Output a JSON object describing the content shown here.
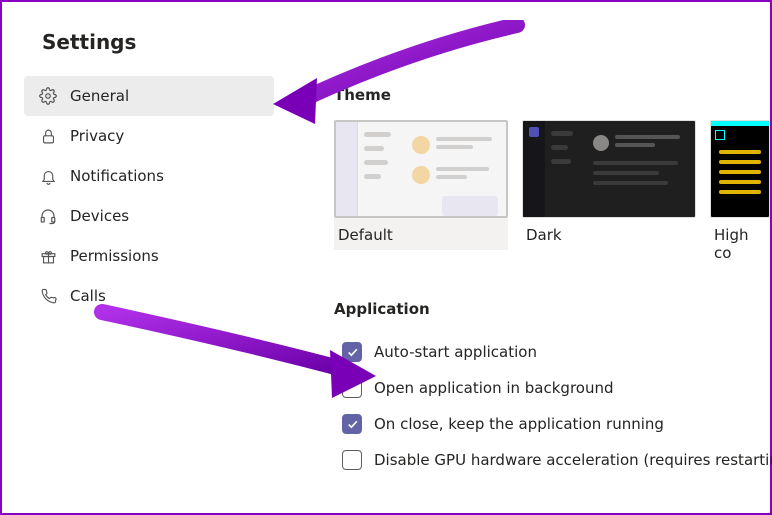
{
  "title": "Settings",
  "accent": "#6264a7",
  "annotation_color": "#8a00c2",
  "sidebar": {
    "items": [
      {
        "label": "General",
        "icon": "gear-icon",
        "active": true
      },
      {
        "label": "Privacy",
        "icon": "lock-icon",
        "active": false
      },
      {
        "label": "Notifications",
        "icon": "bell-icon",
        "active": false
      },
      {
        "label": "Devices",
        "icon": "headset-icon",
        "active": false
      },
      {
        "label": "Permissions",
        "icon": "gift-icon",
        "active": false
      },
      {
        "label": "Calls",
        "icon": "phone-icon",
        "active": false
      }
    ]
  },
  "theme": {
    "heading": "Theme",
    "options": [
      {
        "label": "Default",
        "selected": true
      },
      {
        "label": "Dark",
        "selected": false
      },
      {
        "label": "High co",
        "selected": false
      }
    ]
  },
  "application": {
    "heading": "Application",
    "options": [
      {
        "label": "Auto-start application",
        "checked": true
      },
      {
        "label": "Open application in background",
        "checked": false
      },
      {
        "label": "On close, keep the application running",
        "checked": true
      },
      {
        "label": "Disable GPU hardware acceleration (requires restartin",
        "checked": false
      }
    ]
  }
}
